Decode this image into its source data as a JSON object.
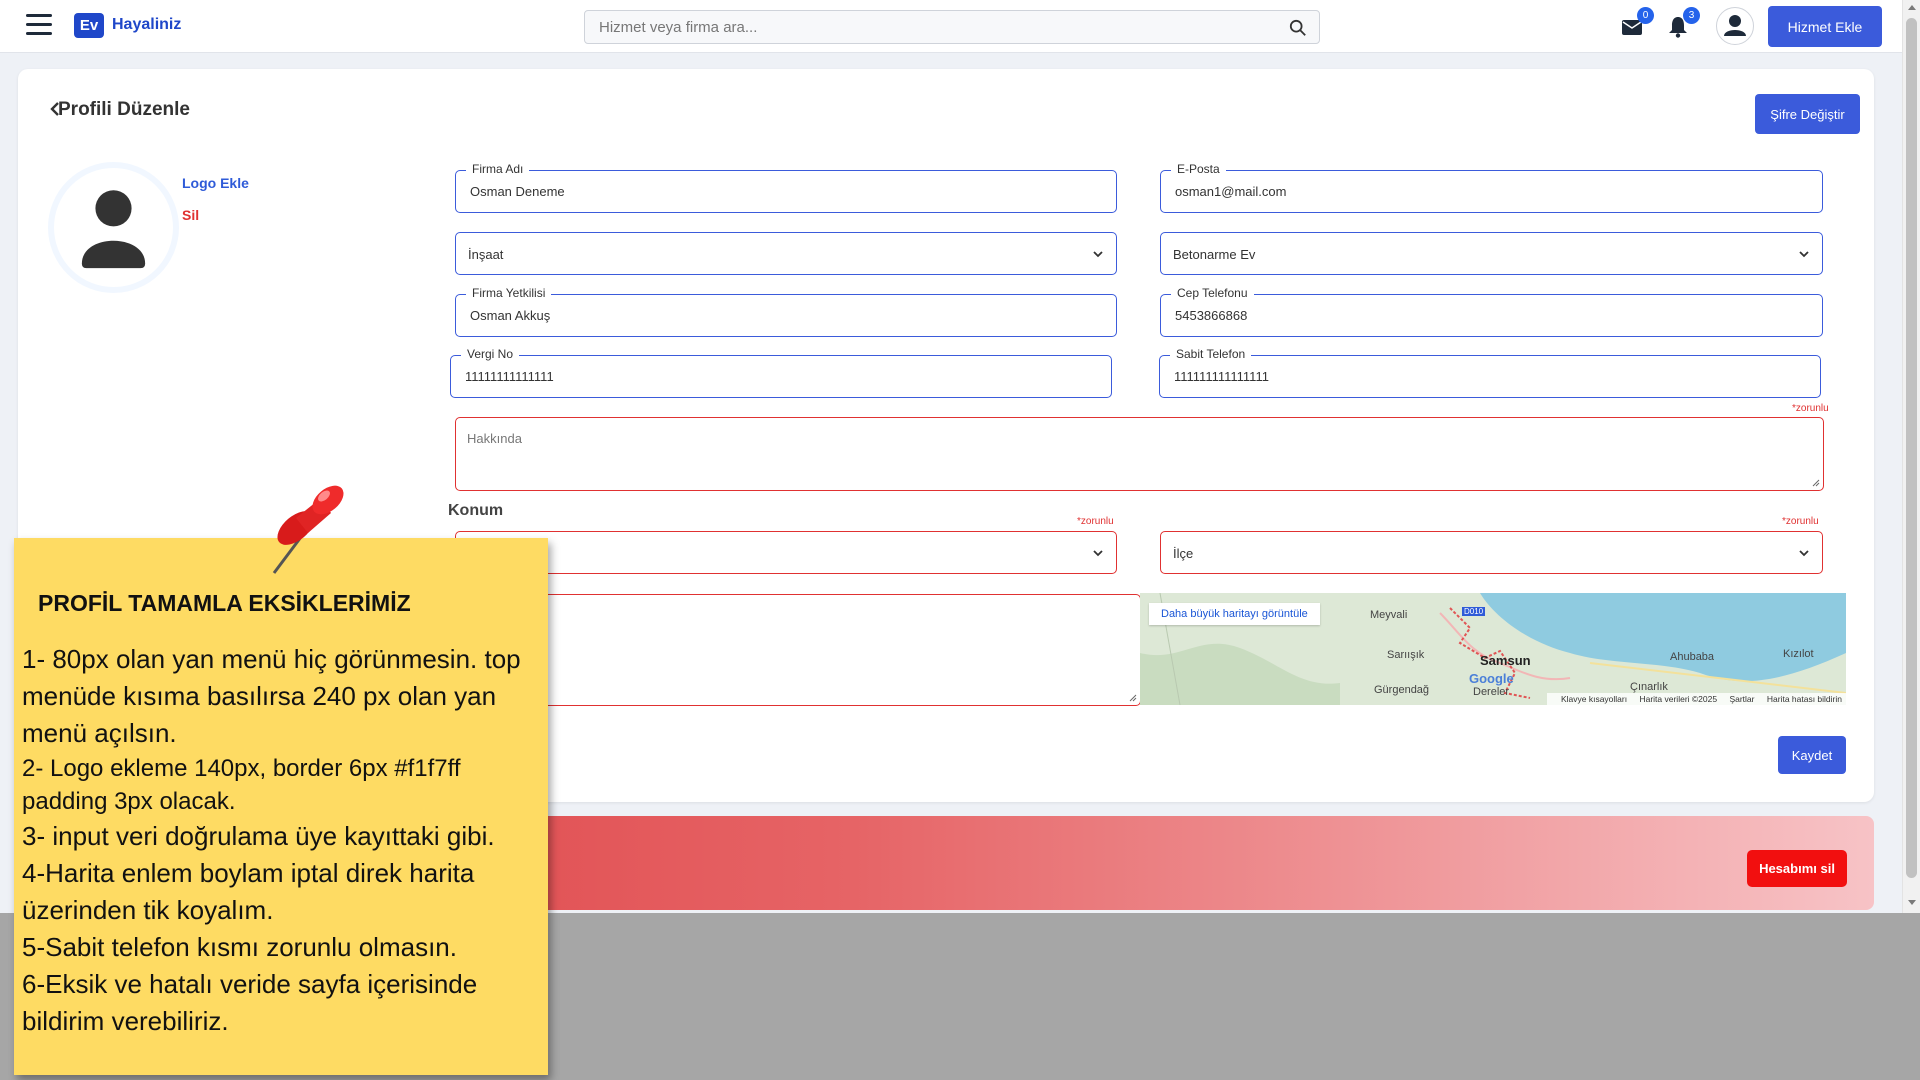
{
  "topbar": {
    "logo_mark": "Ev",
    "logo_text": "Hayaliniz",
    "search_placeholder": "Hizmet veya firma ara...",
    "messages_count": "0",
    "notifications_count": "3",
    "hizmet_ekle": "Hizmet Ekle"
  },
  "page": {
    "title": "Profili Düzenle",
    "sifre_button": "Şifre Değiştir",
    "logo_ekle": "Logo Ekle",
    "sil": "Sil"
  },
  "form": {
    "firma_adi": {
      "label": "Firma Adı",
      "value": "Osman Deneme"
    },
    "eposta": {
      "label": "E-Posta",
      "value": "osman1@mail.com"
    },
    "kategori": {
      "value": "İnşaat"
    },
    "alt_kategori": {
      "value": "Betonarme Ev"
    },
    "firma_yetkilisi": {
      "label": "Firma Yetkilisi",
      "value": "Osman Akkuş"
    },
    "cep_telefonu": {
      "label": "Cep Telefonu",
      "value": "5453866868"
    },
    "vergi_no": {
      "label": "Vergi No",
      "value": "11111111111111"
    },
    "sabit_telefon": {
      "label": "Sabit Telefon",
      "value": "111111111111111"
    },
    "zorunlu": "*zorunlu",
    "hakkinda_placeholder": "Hakkında",
    "konum_title": "Konum",
    "ilce": "İlçe",
    "kaydet": "Kaydet"
  },
  "map": {
    "link": "Daha büyük haritayı görüntüle",
    "labels": [
      "Meyvali",
      "Samsun",
      "Sarıışık",
      "Gürgendağ",
      "Dereler",
      "Ahubaba",
      "Kızılot",
      "Çınarlık",
      "Google",
      "D010"
    ],
    "footer": [
      "Klavye kısayolları",
      "Harita verileri ©2025",
      "Şartlar",
      "Harita hatası bildirin"
    ]
  },
  "danger": {
    "button": "Hesabımı sil"
  },
  "note": {
    "title": "PROFİL TAMAMLA EKSİKLERİMİZ",
    "items": [
      "1- 80px olan yan menü hiç görünmesin. top menüde kısıma basılırsa 240 px olan yan menü açılsın.",
      "2- Logo ekleme 140px, border 6px #f1f7ff padding 3px olacak.",
      "3- input veri doğrulama üye kayıttaki gibi.",
      "4-Harita enlem boylam iptal direk harita üzerinden tik koyalım.",
      "5-Sabit telefon kısmı zorunlu olmasın.",
      "6-Eksik ve hatalı veride sayfa içerisinde bildirim verebiliriz."
    ]
  },
  "colors": {
    "accent": "#3b5bdb",
    "error": "#e03131",
    "note": "#fedb63",
    "danger_button": "#f20f0f"
  }
}
